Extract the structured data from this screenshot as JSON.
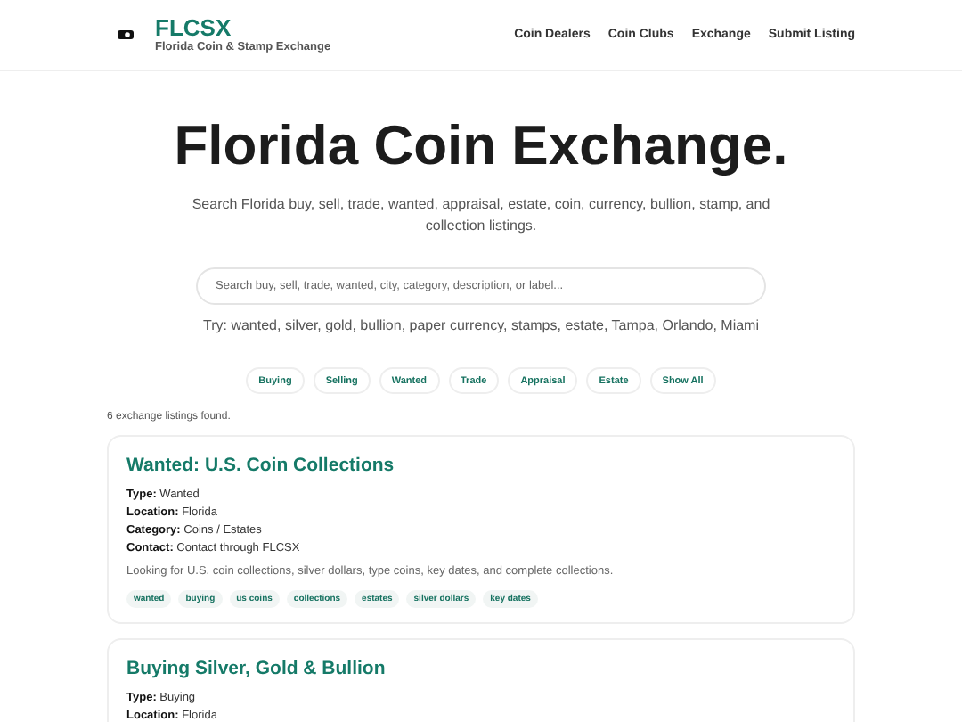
{
  "header": {
    "brand": "FLCSX",
    "tagline": "Florida Coin & Stamp Exchange",
    "nav": [
      "Coin Dealers",
      "Coin Clubs",
      "Exchange",
      "Submit Listing"
    ]
  },
  "hero": {
    "title": "Florida Coin Exchange.",
    "subtitle": "Search Florida buy, sell, trade, wanted, appraisal, estate, coin, currency, bullion, stamp, and collection listings.",
    "search": {
      "placeholder": "Search buy, sell, trade, wanted, city, category, description, or label..."
    },
    "hint": "Try: wanted, silver, gold, bullion, paper currency, stamps, estate, Tampa, Orlando, Miami"
  },
  "filters": [
    "Buying",
    "Selling",
    "Wanted",
    "Trade",
    "Appraisal",
    "Estate",
    "Show All"
  ],
  "result_count": "6 exchange listings found.",
  "listings": [
    {
      "title": "Wanted: U.S. Coin Collections",
      "fields": [
        {
          "label": "Type:",
          "value": "Wanted"
        },
        {
          "label": "Location:",
          "value": "Florida"
        },
        {
          "label": "Category:",
          "value": "Coins / Estates"
        },
        {
          "label": "Contact:",
          "value": "Contact through FLCSX"
        }
      ],
      "description": "Looking for U.S. coin collections, silver dollars, type coins, key dates, and complete collections.",
      "tags": [
        "wanted",
        "buying",
        "us coins",
        "collections",
        "estates",
        "silver dollars",
        "key dates"
      ]
    },
    {
      "title": "Buying Silver, Gold & Bullion",
      "fields": [
        {
          "label": "Type:",
          "value": "Buying"
        },
        {
          "label": "Location:",
          "value": "Florida"
        }
      ]
    }
  ]
}
